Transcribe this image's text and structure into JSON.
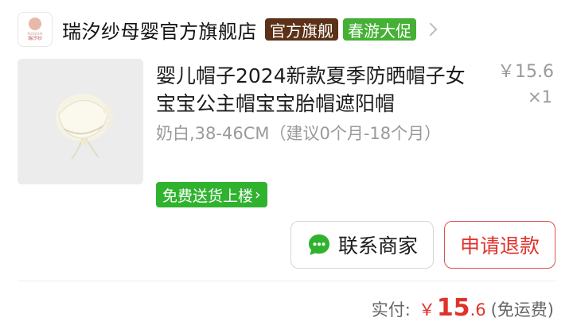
{
  "shop": {
    "logo_text": "瑞汐纱",
    "logo_tiny": "RUIXISHA",
    "name": "瑞汐纱母婴官方旗舰店",
    "badge_official": "官方旗舰",
    "badge_promo": "春游大促"
  },
  "product": {
    "title": "婴儿帽子2024新款夏季防晒帽子女宝宝公主帽宝宝胎帽遮阳帽",
    "price": "￥15.6",
    "quantity": "×1",
    "sku": "奶白,38-46CM（建议0个月-18个月）",
    "delivery_tag": "免费送货上楼",
    "delivery_arrow": "›"
  },
  "actions": {
    "contact_label": "联系商家",
    "refund_label": "申请退款"
  },
  "total": {
    "label": "实付:",
    "currency": "￥",
    "integer": "15",
    "decimal": ".6",
    "note": "(免运费)"
  },
  "colors": {
    "official_badge": "#5b3117",
    "promo_badge": "#45b035",
    "delivery_green": "#2fb32f",
    "accent_red": "#e0322a"
  },
  "icons": {
    "shop_chevron": "chevron-right-icon",
    "chat": "chat-bubble-icon"
  }
}
